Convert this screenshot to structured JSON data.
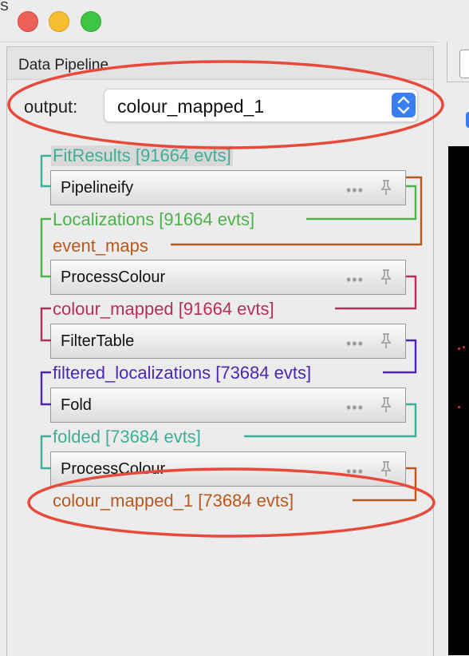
{
  "window": {
    "edge_mark": "S",
    "colors": {
      "close": "#ee5f58",
      "minimize": "#f7be2f",
      "maximize": "#3fc544"
    }
  },
  "panel": {
    "title": "Data Pipeline"
  },
  "output": {
    "label": "output:",
    "selected": "colour_mapped_1",
    "accent": "#3a7ef5"
  },
  "pipeline": {
    "datasources": [
      {
        "label": "FitResults [91664 evts]",
        "color": "#3dae97",
        "highlighted": true
      },
      {
        "label": "Localizations [91664 evts]",
        "color": "#4cb14a"
      },
      {
        "label": "event_maps",
        "color": "#b8581e"
      },
      {
        "label": "colour_mapped [91664 evts]",
        "color": "#b33056"
      },
      {
        "label": "filtered_localizations [73684 evts]",
        "color": "#4c26b1"
      },
      {
        "label": "folded [73684 evts]",
        "color": "#3dae97"
      },
      {
        "label": "colour_mapped_1 [73684 evts]",
        "color": "#b8581e"
      }
    ],
    "modules": [
      {
        "name": "Pipelineify",
        "dots": "•••"
      },
      {
        "name": "ProcessColour",
        "dots": "•••"
      },
      {
        "name": "FilterTable",
        "dots": "•••"
      },
      {
        "name": "Fold",
        "dots": "•••"
      },
      {
        "name": "ProcessColour",
        "dots": "•••"
      }
    ]
  },
  "annotation": {
    "color": "#e8493b"
  }
}
